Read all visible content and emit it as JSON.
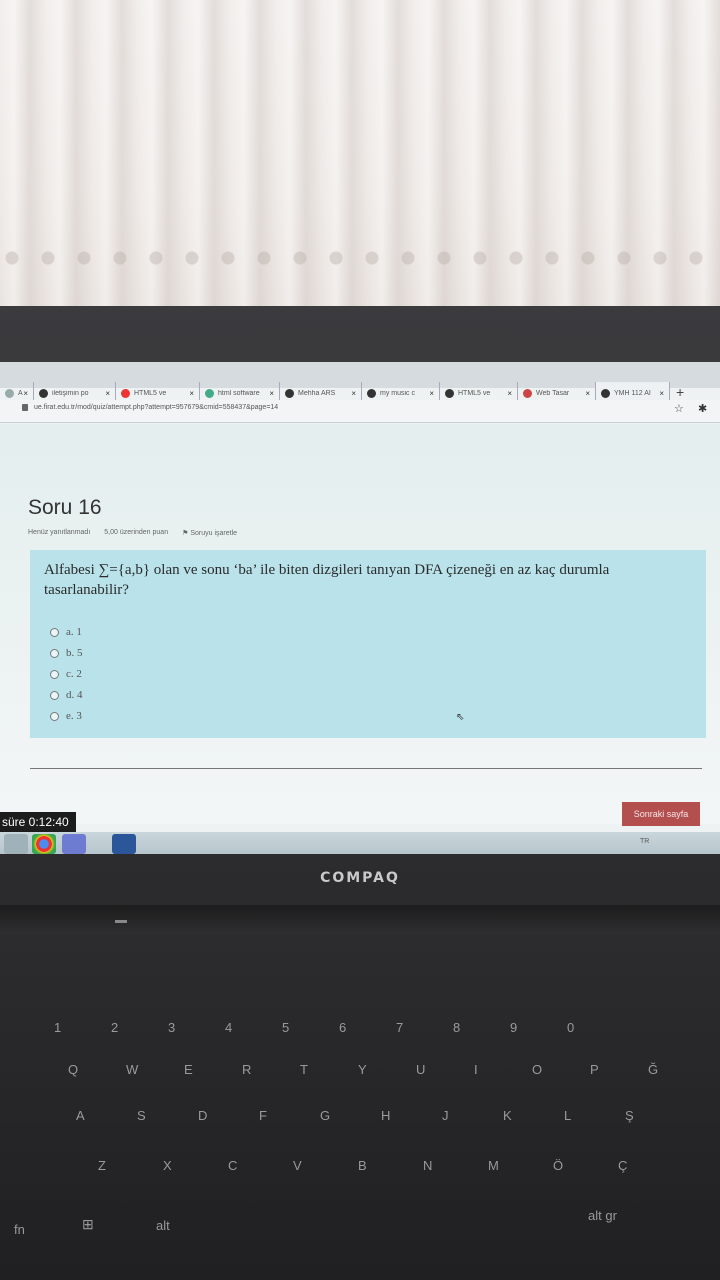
{
  "browser": {
    "tabs": [
      {
        "label": "Al",
        "icon": "generic-icon",
        "color": "#9aa"
      },
      {
        "label": "iletişimin po",
        "icon": "site-icon",
        "color": "#333"
      },
      {
        "label": "HTML5 ve",
        "icon": "youtube-icon",
        "color": "#e33"
      },
      {
        "label": "html software",
        "icon": "google-icon",
        "color": "#4a8"
      },
      {
        "label": "Mehha ARS",
        "icon": "site-icon",
        "color": "#333"
      },
      {
        "label": "my music c",
        "icon": "site-icon",
        "color": "#333"
      },
      {
        "label": "HTML5 ve",
        "icon": "w-icon",
        "color": "#333"
      },
      {
        "label": "Web Tasar",
        "icon": "site-icon",
        "color": "#c44"
      },
      {
        "label": "YMH 112 AI",
        "icon": "site-icon",
        "color": "#333"
      }
    ],
    "url": "ue.firat.edu.tr/mod/quiz/attempt.php?attempt=957679&cmid=558437&page=14"
  },
  "quiz": {
    "title": "Soru 16",
    "status": "Henüz yanıtlanmadı",
    "points": "5,00 üzerinden puan",
    "flag": "Soruyu işaretle",
    "question": "Alfabesi ∑={a,b} olan ve sonu ‘ba’ ile biten dizgileri tanıyan DFA çizeneği en az kaç durumla tasarlanabilir?",
    "options": [
      {
        "label": "a. 1"
      },
      {
        "label": "b. 5"
      },
      {
        "label": "c. 2"
      },
      {
        "label": "d. 4"
      },
      {
        "label": "e. 3"
      }
    ],
    "next_button": "Sonraki sayfa",
    "timer": "süre 0:12:40"
  },
  "taskbar": {
    "tray_text": "TR"
  },
  "laptop": {
    "brand": "COMPAQ"
  },
  "keyboard": {
    "row_numbers": [
      "1",
      "2",
      "3",
      "4",
      "5",
      "6",
      "7",
      "8",
      "9",
      "0"
    ],
    "row_q": [
      "Q",
      "W",
      "E",
      "R",
      "T",
      "Y",
      "U",
      "I",
      "O",
      "P",
      "Ğ"
    ],
    "row_a": [
      "A",
      "S",
      "D",
      "F",
      "G",
      "H",
      "J",
      "K",
      "L",
      "Ş"
    ],
    "row_z": [
      "Z",
      "X",
      "C",
      "V",
      "B",
      "N",
      "M",
      "Ö",
      "Ç"
    ],
    "fn": "fn",
    "alt": "alt",
    "alt_gr": "alt gr"
  }
}
